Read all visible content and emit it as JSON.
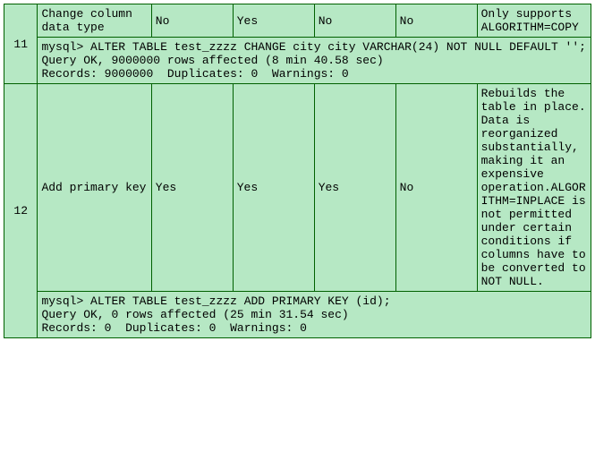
{
  "rows": [
    {
      "num": "11",
      "operation": "Change column data type",
      "inplace": "No",
      "rebuild": "Yes",
      "concurrent": "No",
      "metadata": "No",
      "notes": "Only supports ALGORITHM=COPY",
      "cmd": "mysql> ALTER TABLE test_zzzz CHANGE city city VARCHAR(24) NOT NULL DEFAULT '';\nQuery OK, 9000000 rows affected (8 min 40.58 sec)\nRecords: 9000000  Duplicates: 0  Warnings: 0"
    },
    {
      "num": "12",
      "operation": "Add primary key",
      "inplace": "Yes",
      "rebuild": "Yes",
      "concurrent": "Yes",
      "metadata": "No",
      "notes": "Rebuilds the table in place. Data is reorganized substantially, making it an expensive operation.ALGORITHM=INPLACE is not permitted under certain conditions if columns have to be converted to NOT NULL.",
      "cmd": "mysql> ALTER TABLE test_zzzz ADD PRIMARY KEY (id);\nQuery OK, 0 rows affected (25 min 31.54 sec)\nRecords: 0  Duplicates: 0  Warnings: 0"
    }
  ]
}
